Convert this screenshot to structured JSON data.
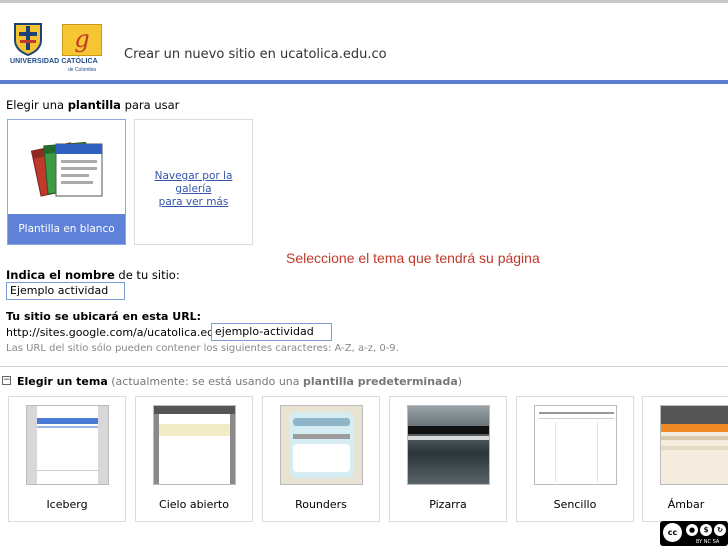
{
  "header": {
    "logo_line1": "UNIVERSIDAD CATÓLICA",
    "logo_line2": "de Colombia",
    "logo_g": "g",
    "title": "Crear un nuevo sitio en ucatolica.edu.co"
  },
  "template": {
    "label_pre": "Elegir una ",
    "label_bold": "plantilla",
    "label_post": " para usar",
    "blank_caption": "Plantilla en blanco",
    "gallery_line1": "Navegar por la galería",
    "gallery_line2": "para ver más"
  },
  "annotation": "Seleccione el tema que tendrá su página",
  "site_name": {
    "label_bold": "Indica el nombre",
    "label_post": " de tu sitio:",
    "value": "Ejemplo actividad"
  },
  "site_url": {
    "label": "Tu sitio se ubicará en esta URL:",
    "prefix": "http://sites.google.com/a/ucatolica.edu.co/",
    "value": "ejemplo-actividad",
    "hint": "Las URL del sitio sólo pueden contener los siguientes caracteres: A-Z, a-z, 0-9."
  },
  "theme": {
    "collapse_symbol": "−",
    "label": "Elegir un tema",
    "note_pre": " (actualmente: se está usando una ",
    "note_bold": "plantilla predeterminada",
    "note_post": ")",
    "items": [
      {
        "name": "Iceberg"
      },
      {
        "name": "Cielo abierto"
      },
      {
        "name": "Rounders"
      },
      {
        "name": "Pizarra"
      },
      {
        "name": "Sencillo"
      },
      {
        "name": "Ámbar"
      }
    ]
  },
  "license": {
    "cc": "cc",
    "sub": "BY  NC  SA"
  },
  "colors": {
    "header_bar": "#5b7fcf",
    "selected_template": "#5f82d8",
    "annotation": "#c0392b",
    "link": "#3355aa"
  }
}
